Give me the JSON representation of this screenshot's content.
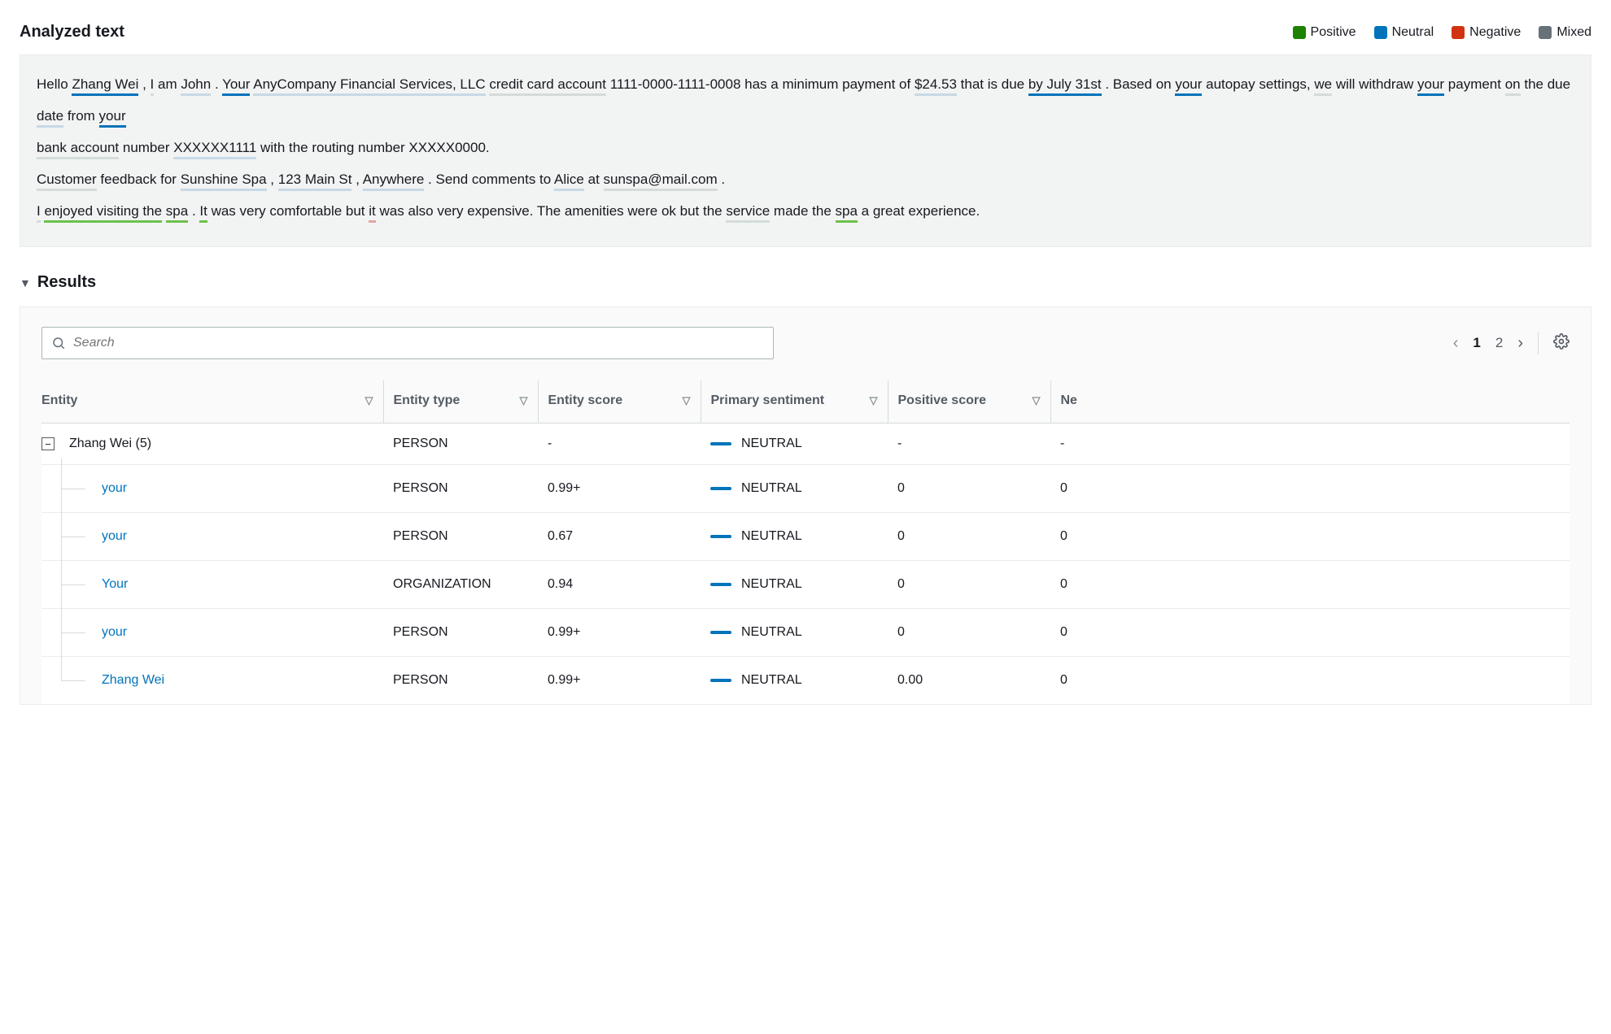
{
  "header": {
    "title": "Analyzed text"
  },
  "legend": {
    "positive": "Positive",
    "neutral": "Neutral",
    "negative": "Negative",
    "mixed": "Mixed"
  },
  "icons": {
    "search": "search-icon",
    "gear": "gear-icon",
    "caret_down": "caret-down-icon",
    "page_prev": "page-prev-icon",
    "page_next": "page-next-icon",
    "expand_minus": "expand-collapse-icon",
    "sort_caret": "sort-caret-icon"
  },
  "text": {
    "tokens": [
      {
        "t": "Hello "
      },
      {
        "t": "Zhang Wei",
        "u": "neutral"
      },
      {
        "t": " , "
      },
      {
        "t": "I",
        "u": "light"
      },
      {
        "t": " am "
      },
      {
        "t": "John",
        "u": "lightblue"
      },
      {
        "t": " . "
      },
      {
        "t": "Your",
        "u": "neutral"
      },
      {
        "t": "  "
      },
      {
        "t": "AnyCompany Financial Services, LLC",
        "u": "lightblue"
      },
      {
        "t": "  "
      },
      {
        "t": "credit card account",
        "u": "light"
      },
      {
        "t": "  "
      },
      {
        "t": "1111-0000-1111-0008 has a minimum payment of "
      },
      {
        "t": "$24.53",
        "u": "lightblue"
      },
      {
        "t": "  that is due "
      },
      {
        "t": "by July 31st",
        "u": "neutral"
      },
      {
        "t": " . Based on "
      },
      {
        "t": "your",
        "u": "neutral"
      },
      {
        "t": "  autopay settings, "
      },
      {
        "t": "we",
        "u": "light"
      },
      {
        "t": "  will withdraw "
      },
      {
        "t": "your",
        "u": "neutral"
      },
      {
        "t": "  payment "
      },
      {
        "t": "on",
        "u": "light"
      },
      {
        "t": "  the due "
      },
      {
        "t": "date",
        "u": "lightblue"
      },
      {
        "t": "  from "
      },
      {
        "t": "your",
        "u": "neutral"
      },
      {
        "t": "  ",
        "break": true
      },
      {
        "t": "bank account",
        "u": "light"
      },
      {
        "t": "  number "
      },
      {
        "t": "XXXXXX1111",
        "u": "lightblue"
      },
      {
        "t": "  with the routing number XXXXX0000.",
        "break": true
      },
      {
        "t": "Customer",
        "u": "light"
      },
      {
        "t": "  feedback for "
      },
      {
        "t": "Sunshine Spa",
        "u": "lightblue"
      },
      {
        "t": " , "
      },
      {
        "t": "123 Main St",
        "u": "lightblue"
      },
      {
        "t": " , "
      },
      {
        "t": "Anywhere",
        "u": "lightblue"
      },
      {
        "t": " . Send comments to "
      },
      {
        "t": "Alice",
        "u": "lightblue"
      },
      {
        "t": "  at "
      },
      {
        "t": "sunspa@mail.com",
        "u": "light"
      },
      {
        "t": " .",
        "break": true
      },
      {
        "t": "I",
        "u": "light"
      },
      {
        "t": "  "
      },
      {
        "t": "enjoyed visiting the",
        "u": "positive"
      },
      {
        "t": " "
      },
      {
        "t": "spa",
        "u": "positive"
      },
      {
        "t": " . "
      },
      {
        "t": "It",
        "u": "positive"
      },
      {
        "t": "  was very comfortable but "
      },
      {
        "t": "it",
        "u": "negative"
      },
      {
        "t": "  was also very expensive. The amenities were ok but the "
      },
      {
        "t": "service",
        "u": "light"
      },
      {
        "t": "  made the "
      },
      {
        "t": "spa",
        "u": "positive"
      },
      {
        "t": "  a great experience."
      }
    ]
  },
  "results": {
    "label": "Results",
    "search_placeholder": "Search",
    "pagination": {
      "current": 1,
      "pages": [
        "1",
        "2"
      ]
    },
    "columns": {
      "entity": "Entity",
      "entity_type": "Entity type",
      "entity_score": "Entity score",
      "primary_sentiment": "Primary sentiment",
      "positive_score": "Positive score",
      "negative_score": "Ne"
    },
    "group": {
      "entity": "Zhang Wei (5)",
      "entity_type": "PERSON",
      "entity_score": "-",
      "sentiment": "NEUTRAL",
      "positive": "-",
      "negative": "-"
    },
    "rows": [
      {
        "entity": "your",
        "entity_type": "PERSON",
        "entity_score": "0.99+",
        "sentiment": "NEUTRAL",
        "positive": "0",
        "negative": "0"
      },
      {
        "entity": "your",
        "entity_type": "PERSON",
        "entity_score": "0.67",
        "sentiment": "NEUTRAL",
        "positive": "0",
        "negative": "0"
      },
      {
        "entity": "Your",
        "entity_type": "ORGANIZATION",
        "entity_score": "0.94",
        "sentiment": "NEUTRAL",
        "positive": "0",
        "negative": "0"
      },
      {
        "entity": "your",
        "entity_type": "PERSON",
        "entity_score": "0.99+",
        "sentiment": "NEUTRAL",
        "positive": "0",
        "negative": "0"
      },
      {
        "entity": "Zhang Wei",
        "entity_type": "PERSON",
        "entity_score": "0.99+",
        "sentiment": "NEUTRAL",
        "positive": "0.00",
        "negative": "0"
      }
    ]
  }
}
